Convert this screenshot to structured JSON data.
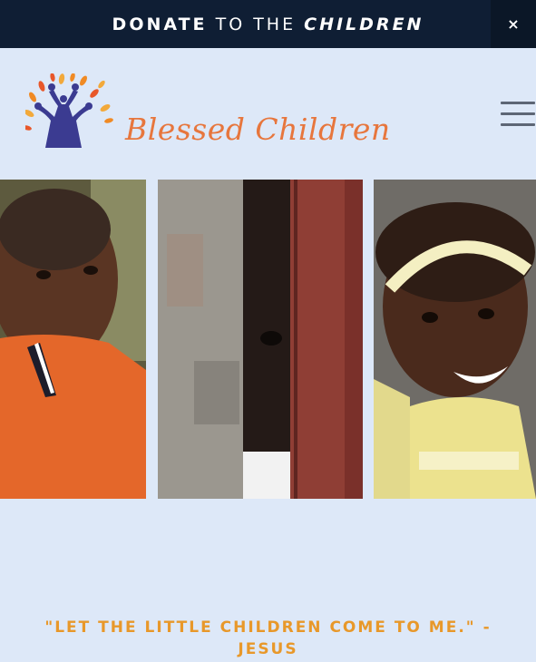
{
  "banner": {
    "word1": "DONATE",
    "word2": "TO THE",
    "word3": "CHILDREN",
    "close_label": "×"
  },
  "header": {
    "brand_name": "Blessed Children",
    "logo_icon": "tree-of-people-logo",
    "menu_icon": "hamburger-menu-icon"
  },
  "gallery": {
    "photos": [
      {
        "name": "boy-in-orange-shirt-photo"
      },
      {
        "name": "child-peeking-behind-wall-photo"
      },
      {
        "name": "smiling-girl-with-headband-photo"
      }
    ]
  },
  "quote": {
    "text": "\"LET THE LITTLE CHILDREN COME TO ME.\" - JESUS"
  },
  "colors": {
    "banner_bg": "#0f1e34",
    "page_bg": "#dde8f8",
    "brand_orange": "#e7763d",
    "quote_gold": "#e8982a",
    "logo_purple": "#3b3b91"
  }
}
